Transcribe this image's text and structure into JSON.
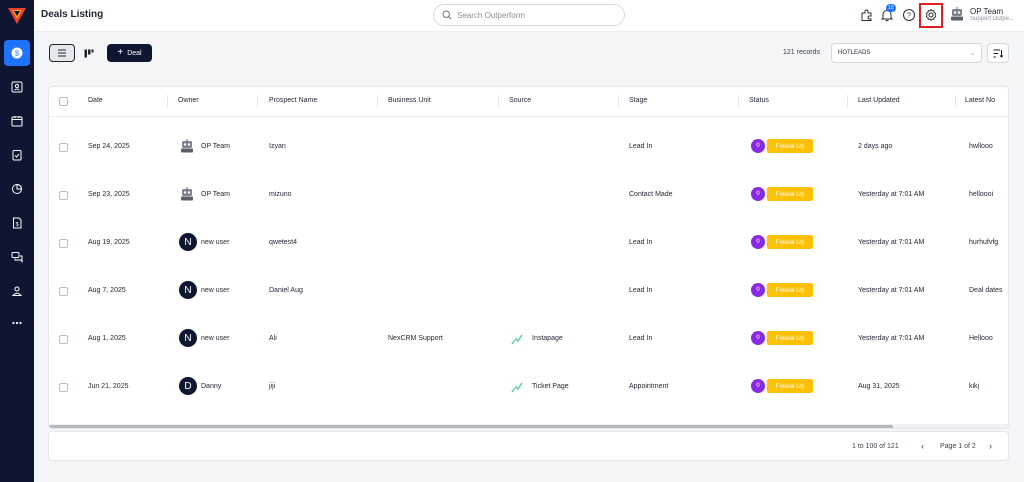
{
  "header": {
    "title": "Deals Listing",
    "search_placeholder": "Search Outperform",
    "notification_count": "10",
    "user_name": "OP Team",
    "user_subtitle": "Support Outpe..."
  },
  "toolbar": {
    "add_deal_label": "Deal",
    "records_text": "121 records",
    "view_selected": "HOTLEADS"
  },
  "table": {
    "columns": [
      "Date",
      "Owner",
      "Prospect Name",
      "Business Unit",
      "Source",
      "Stage",
      "Status",
      "Last Updated",
      "Latest No"
    ],
    "rows": [
      {
        "date": "Sep 24, 2025",
        "owner": "OP Team",
        "owner_type": "robot",
        "prospect": "Izyan",
        "business_unit": "",
        "source": "",
        "stage": "Lead In",
        "status_count": "0",
        "status": "Follow Up",
        "last_updated": "2 days ago",
        "latest_note": "hwllooo"
      },
      {
        "date": "Sep 23, 2025",
        "owner": "OP Team",
        "owner_type": "robot",
        "prospect": "mizuno",
        "business_unit": "",
        "source": "",
        "stage": "Contact Made",
        "status_count": "0",
        "status": "Follow Up",
        "last_updated": "Yesterday at 7:01 AM",
        "latest_note": "helloooi"
      },
      {
        "date": "Aug 19, 2025",
        "owner": "new user",
        "owner_type": "letter",
        "owner_letter": "N",
        "prospect": "qwetest4",
        "business_unit": "",
        "source": "",
        "stage": "Lead In",
        "status_count": "0",
        "status": "Follow Up",
        "last_updated": "Yesterday at 7:01 AM",
        "latest_note": "hurhufvfg"
      },
      {
        "date": "Aug 7, 2025",
        "owner": "new user",
        "owner_type": "letter",
        "owner_letter": "N",
        "prospect": "Daniel Aug",
        "business_unit": "",
        "source": "",
        "stage": "Lead In",
        "status_count": "0",
        "status": "Follow Up",
        "last_updated": "Yesterday at 7:01 AM",
        "latest_note": "Deal dates"
      },
      {
        "date": "Aug 1, 2025",
        "owner": "new user",
        "owner_type": "letter",
        "owner_letter": "N",
        "prospect": "Ali",
        "business_unit": "NexCRM Support",
        "source": "Instapage",
        "stage": "Lead In",
        "status_count": "0",
        "status": "Follow Up",
        "last_updated": "Yesterday at 7:01 AM",
        "latest_note": "Hellooo"
      },
      {
        "date": "Jun 21, 2025",
        "owner": "Danny",
        "owner_type": "letter",
        "owner_letter": "D",
        "prospect": "jiji",
        "business_unit": "",
        "source": "Ticket Page",
        "stage": "Appointment",
        "status_count": "0",
        "status": "Follow Up",
        "last_updated": "Aug 31, 2025",
        "latest_note": "kikj"
      }
    ]
  },
  "pagination": {
    "range_text": "1 to 100 of 121",
    "page_text": "Page 1 of 2"
  },
  "colors": {
    "sidebar": "#0f1631",
    "accent": "#1f74ff",
    "status_tag": "#ffc107",
    "status_count": "#8a2be2",
    "highlight": "#e02020"
  },
  "icons": {
    "sidebar": [
      "dollar-icon",
      "contacts-icon",
      "calendar-icon",
      "clipboard-check-icon",
      "pie-chart-icon",
      "document-dollar-icon",
      "chat-icon",
      "users-icon",
      "more-icon"
    ],
    "header": [
      "puzzle-icon",
      "bell-icon",
      "help-icon",
      "gear-icon"
    ]
  }
}
